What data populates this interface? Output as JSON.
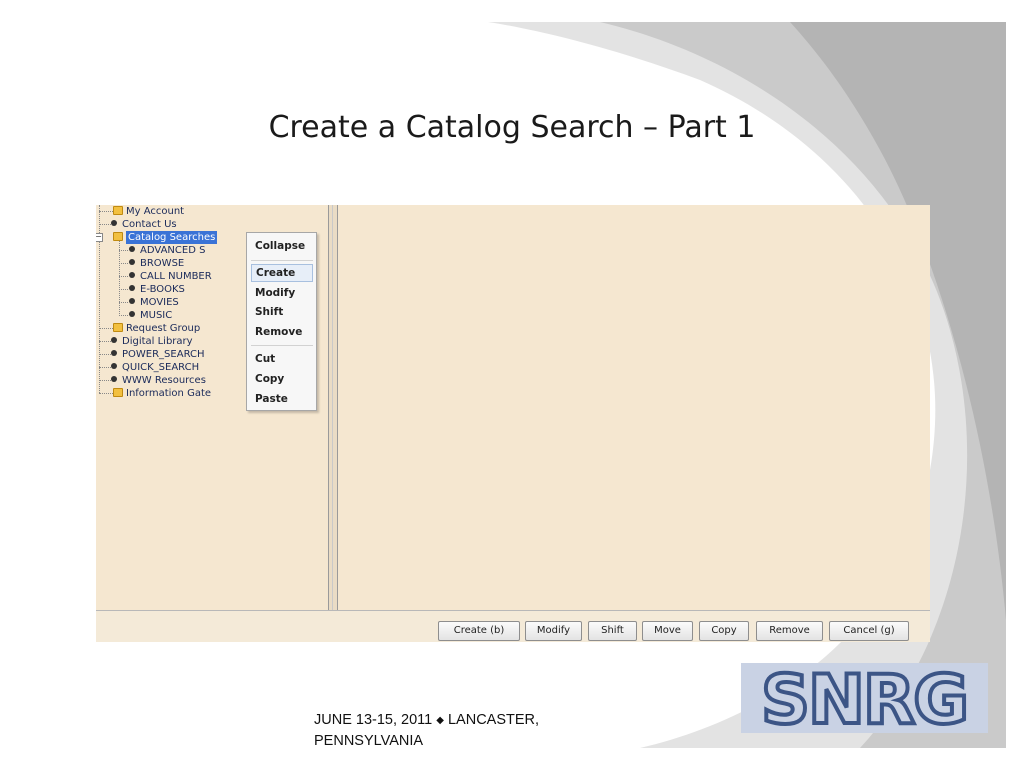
{
  "slide": {
    "title": "Create a Catalog Search – Part 1",
    "footer_date": "JUNE 13-15, 2011",
    "footer_separator": "◆",
    "footer_place": "LANCASTER, PENNSYLVANIA"
  },
  "logo": {
    "text": "SNRG",
    "color": "#3c5586"
  },
  "tree": {
    "items": [
      {
        "label": "My Account",
        "kind": "folder"
      },
      {
        "label": "Contact Us",
        "kind": "bullet"
      },
      {
        "label": "Catalog Searches",
        "kind": "folder",
        "selected": true
      },
      {
        "label": "ADVANCED S",
        "kind": "bullet",
        "child": true
      },
      {
        "label": "BROWSE",
        "kind": "bullet",
        "child": true
      },
      {
        "label": "CALL NUMBER",
        "kind": "bullet",
        "child": true
      },
      {
        "label": "E-BOOKS",
        "kind": "bullet",
        "child": true
      },
      {
        "label": "MOVIES",
        "kind": "bullet",
        "child": true
      },
      {
        "label": "MUSIC",
        "kind": "bullet",
        "child": true
      },
      {
        "label": "Request Group",
        "kind": "folder"
      },
      {
        "label": "Digital Library",
        "kind": "bullet"
      },
      {
        "label": "POWER_SEARCH",
        "kind": "bullet"
      },
      {
        "label": "QUICK_SEARCH",
        "kind": "bullet"
      },
      {
        "label": "WWW Resources",
        "kind": "bullet"
      },
      {
        "label": "Information Gate",
        "kind": "folder"
      }
    ]
  },
  "context_menu": {
    "items": [
      "Collapse",
      "Create",
      "Modify",
      "Shift",
      "Remove",
      "Cut",
      "Copy",
      "Paste"
    ],
    "highlighted": "Create"
  },
  "buttons": [
    "Create (b)",
    "Modify",
    "Shift",
    "Move",
    "Copy",
    "Remove",
    "Cancel (g)"
  ]
}
